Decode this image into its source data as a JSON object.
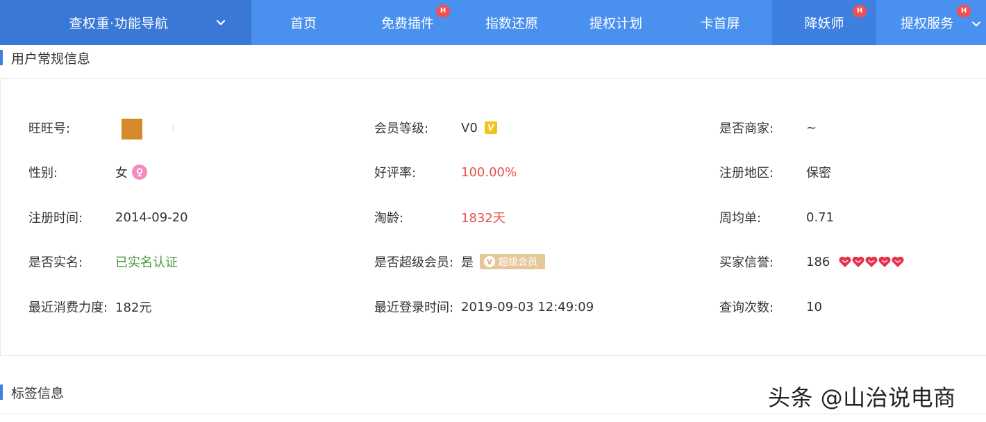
{
  "nav": {
    "menu_label": "查权重·功能导航",
    "items": [
      {
        "label": "首页",
        "badge": ""
      },
      {
        "label": "免费插件",
        "badge": "H"
      },
      {
        "label": "指数还原",
        "badge": ""
      },
      {
        "label": "提权计划",
        "badge": ""
      },
      {
        "label": "卡首屏",
        "badge": ""
      },
      {
        "label": "降妖师",
        "badge": "H"
      },
      {
        "label": "提权服务",
        "badge": "H"
      }
    ]
  },
  "section_user": {
    "title": "用户常规信息"
  },
  "user_info": {
    "wangwang_label": "旺旺号:",
    "member_level_label": "会员等级:",
    "member_level_value": "V0",
    "member_level_icon": "V",
    "is_merchant_label": "是否商家:",
    "is_merchant_value": "~",
    "gender_label": "性别:",
    "gender_value": "女",
    "good_rate_label": "好评率:",
    "good_rate_value": "100.00%",
    "region_label": "注册地区:",
    "region_value": "保密",
    "reg_time_label": "注册时间:",
    "reg_time_value": "2014-09-20",
    "taobao_age_label": "淘龄:",
    "taobao_age_value": "1832天",
    "weekly_orders_label": "周均单:",
    "weekly_orders_value": "0.71",
    "real_name_label": "是否实名:",
    "real_name_value": "已实名认证",
    "super_member_label": "是否超级会员:",
    "super_member_value": "是",
    "super_badge_label": "超级会员",
    "super_badge_icon": "V",
    "buyer_credit_label": "买家信誉:",
    "buyer_credit_value": "186",
    "recent_spend_label": "最近消费力度:",
    "recent_spend_value": "182元",
    "last_login_label": "最近登录时间:",
    "last_login_value": "2019-09-03 12:49:09",
    "query_count_label": "查询次数:",
    "query_count_value": "10"
  },
  "section_tags": {
    "title": "标签信息"
  },
  "watermark": "头条 @山治说电商",
  "colors": {
    "nav_bg": "#4a90ee",
    "nav_menu_bg": "#3a78d8",
    "accent": "#3d80e0",
    "red_value": "#e8504a",
    "green_value": "#4a9a3c",
    "badge": "#f05050"
  }
}
